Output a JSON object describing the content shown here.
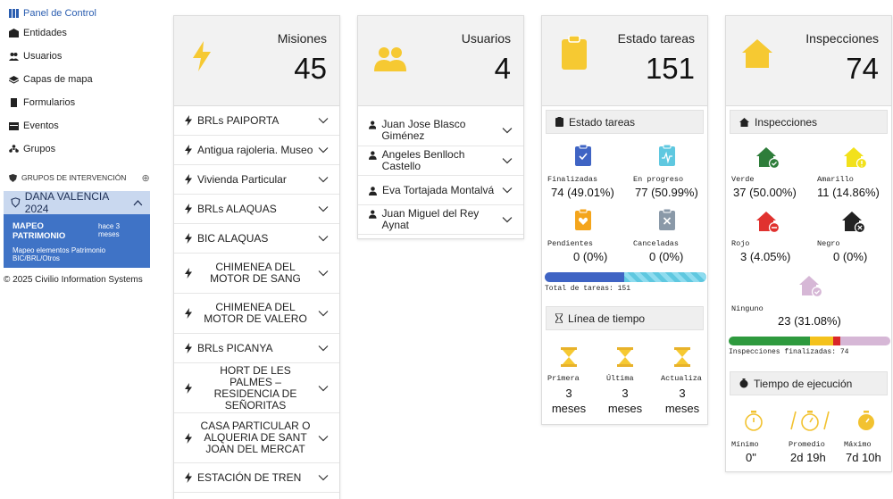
{
  "sidebar": {
    "items": [
      {
        "label": "Panel de Control",
        "icon": "dashboard-icon"
      },
      {
        "label": "Entidades",
        "icon": "building-icon"
      },
      {
        "label": "Usuarios",
        "icon": "users-icon"
      },
      {
        "label": "Capas de mapa",
        "icon": "layers-icon"
      },
      {
        "label": "Formularios",
        "icon": "form-icon"
      },
      {
        "label": "Eventos",
        "icon": "calendar-icon"
      },
      {
        "label": "Grupos",
        "icon": "groups-icon"
      }
    ],
    "section_label": "GRUPOS DE INTERVENCIÓN",
    "group": {
      "name": "DANA VALENCIA 2024",
      "card_title": "MAPEO PATRIMONIO",
      "card_time": "hace 3 meses",
      "card_subtitle": "Mapeo elementos Patrimonio BIC/BRL/Otros"
    },
    "copyright": "© 2025 Civilio Information Systems"
  },
  "misiones": {
    "title": "Misiones",
    "count": "45",
    "items": [
      "BRLs PAIPORTA",
      "Antigua rajoleria. Museo",
      "Vivienda Particular",
      "BRLs ALAQUAS",
      "BIC ALAQUAS",
      "CHIMENEA DEL MOTOR DE SANG",
      "CHIMENEA DEL MOTOR DE VALERO",
      "BRLs PICANYA",
      "HORT DE LES PALMES – RESIDENCIA DE SEÑORITAS",
      "CASA PARTICULAR O ALQUERIA DE SANT JOAN DEL MERCAT",
      "ESTACIÓN DE TREN"
    ]
  },
  "usuarios": {
    "title": "Usuarios",
    "count": "4",
    "items": [
      "Juan Jose Blasco Giménez",
      "Angeles Benlloch Castello",
      "Eva Tortajada Montalvá",
      "Juan Miguel del Rey Aynat"
    ]
  },
  "estado": {
    "title": "Estado tareas",
    "count": "151",
    "sub_title": "Estado tareas",
    "stats": [
      {
        "label": "Finalizadas",
        "value": "74 (49.01%)",
        "color": "#3f64c4"
      },
      {
        "label": "En progreso",
        "value": "77 (50.99%)",
        "color": "#5fc8e0"
      },
      {
        "label": "Pendientes",
        "value": "0 (0%)",
        "color": "#f4a51c"
      },
      {
        "label": "Canceladas",
        "value": "0 (0%)",
        "color": "#8a99a8"
      }
    ],
    "progress": {
      "finalizadas": 0.4901,
      "en_progreso": 0.5099
    },
    "total_label": "Total de tareas: 151",
    "timeline_title": "Línea de tiempo",
    "timeline": [
      {
        "label": "Primera",
        "value": "3 meses"
      },
      {
        "label": "Última",
        "value": "3 meses"
      },
      {
        "label": "Actualiza",
        "value": "3 meses"
      }
    ]
  },
  "inspecciones": {
    "title": "Inspecciones",
    "count": "74",
    "sub_title": "Inspecciones",
    "stats": [
      {
        "label": "Verde",
        "value": "37 (50.00%)",
        "color": "#2e7d3a"
      },
      {
        "label": "Amarillo",
        "value": "11 (14.86%)",
        "color": "#f2e11b"
      },
      {
        "label": "Rojo",
        "value": "3 (4.05%)",
        "color": "#e0322f"
      },
      {
        "label": "Negro",
        "value": "0 (0%)",
        "color": "#222222"
      }
    ],
    "ninguno": {
      "label": "Ninguno",
      "value": "23 (31.08%)",
      "color": "#d6b7d6"
    },
    "bar": {
      "verde": 0.5,
      "amarillo": 0.1486,
      "rojo": 0.0405,
      "ninguno": 0.3108
    },
    "finalizadas_label": "Inspecciones finalizadas: 74",
    "time_title": "Tiempo de ejecución",
    "time_stats": [
      {
        "label": "Mínimo",
        "value": "0\""
      },
      {
        "label": "Promedio",
        "value": "2d 19h"
      },
      {
        "label": "Máximo",
        "value": "7d 10h"
      }
    ]
  },
  "colors": {
    "accent": "#3f73c6",
    "icon_yellow": "#f6c932",
    "bar_blue": "#3f64c4",
    "bar_cyan": "#5fc8e0"
  }
}
